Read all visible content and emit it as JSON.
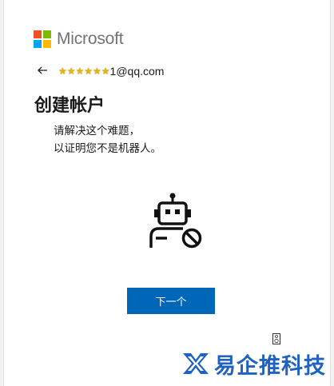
{
  "brand": {
    "name": "Microsoft",
    "squares": [
      "#f25022",
      "#7fba00",
      "#00a4ef",
      "#ffb900"
    ]
  },
  "identity": {
    "back_icon": "arrow-left-icon",
    "masked_stars": "★★★★★★",
    "email_suffix": "1@qq.com"
  },
  "page": {
    "title": "创建帐户",
    "instruction_line1": "请解决这个难题，",
    "instruction_line2": "以证明您不是机器人。"
  },
  "challenge": {
    "icon": "robot-blocked-icon"
  },
  "actions": {
    "next_label": "下一个",
    "accent": "#0067b8",
    "audio_icon": "speaker-icon"
  },
  "watermark": {
    "text": "易企推科技",
    "color": "#1f62c4"
  }
}
